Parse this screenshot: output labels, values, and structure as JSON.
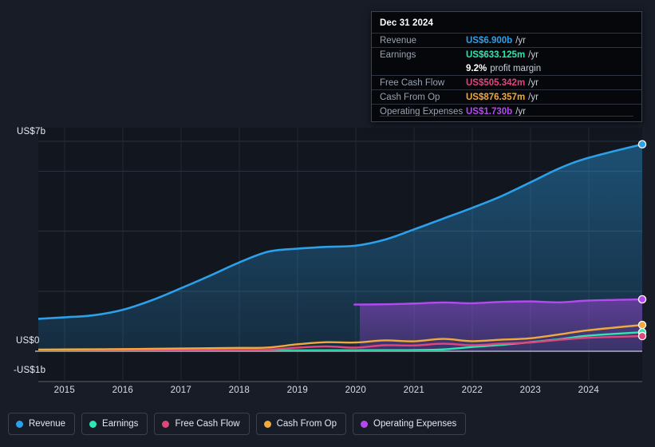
{
  "theme": {
    "background": "#171c26",
    "plot_background": "#12161f",
    "gridline": "#2b3140",
    "zero_line": "#8b8f99",
    "axis_text": "#d7dde7"
  },
  "axes": {
    "y_top_label": "US$7b",
    "y_zero_label": "US$0",
    "y_bottom_label": "-US$1b",
    "x_labels": [
      "2015",
      "2016",
      "2017",
      "2018",
      "2019",
      "2020",
      "2021",
      "2022",
      "2023",
      "2024"
    ]
  },
  "tooltip": {
    "date": "Dec 31 2024",
    "rows": [
      {
        "key": "Revenue",
        "value": "US$6.900b",
        "suffix": "/yr",
        "color": "#2ca0e8"
      },
      {
        "key": "Earnings",
        "value": "US$633.125m",
        "suffix": "/yr",
        "color": "#2ee6b0"
      },
      {
        "key": "Free Cash Flow",
        "value": "US$505.342m",
        "suffix": "/yr",
        "color": "#e0457b"
      },
      {
        "key": "Cash From Op",
        "value": "US$876.357m",
        "suffix": "/yr",
        "color": "#f0a93c"
      },
      {
        "key": "Operating Expenses",
        "value": "US$1.730b",
        "suffix": "/yr",
        "color": "#b449f0"
      }
    ],
    "profit_margin_value": "9.2%",
    "profit_margin_label": "profit margin"
  },
  "legend": [
    {
      "label": "Revenue",
      "color": "#2ca0e8"
    },
    {
      "label": "Earnings",
      "color": "#2ee6b0"
    },
    {
      "label": "Free Cash Flow",
      "color": "#e0457b"
    },
    {
      "label": "Cash From Op",
      "color": "#f0a93c"
    },
    {
      "label": "Operating Expenses",
      "color": "#b449f0"
    }
  ],
  "chart_data": {
    "type": "area",
    "title": "",
    "xlabel": "",
    "ylabel": "US$",
    "ylim": [
      -1,
      7
    ],
    "units": "US$ billions per year",
    "grid": true,
    "legend_position": "bottom",
    "x": [
      2014.55,
      2015,
      2015.5,
      2016,
      2016.5,
      2017,
      2017.5,
      2018,
      2018.5,
      2019,
      2019.5,
      2020,
      2020.5,
      2021,
      2021.5,
      2022,
      2022.5,
      2023,
      2023.5,
      2024,
      2024.92
    ],
    "series": [
      {
        "name": "Revenue",
        "color": "#2ca0e8",
        "fill": true,
        "values": [
          1.08,
          1.13,
          1.2,
          1.38,
          1.7,
          2.1,
          2.52,
          2.96,
          3.32,
          3.42,
          3.48,
          3.52,
          3.72,
          4.06,
          4.42,
          4.78,
          5.17,
          5.63,
          6.1,
          6.45,
          6.9
        ]
      },
      {
        "name": "Operating Expenses",
        "color": "#b449f0",
        "fill": true,
        "start_x": 2020.07,
        "values": [
          null,
          null,
          null,
          null,
          null,
          null,
          null,
          null,
          null,
          null,
          null,
          1.555,
          1.565,
          1.59,
          1.625,
          1.6,
          1.645,
          1.66,
          1.63,
          1.69,
          1.73
        ]
      },
      {
        "name": "Cash From Op",
        "color": "#f0a93c",
        "fill": false,
        "values": [
          0.055,
          0.06,
          0.065,
          0.07,
          0.08,
          0.09,
          0.1,
          0.11,
          0.125,
          0.23,
          0.3,
          0.29,
          0.36,
          0.33,
          0.41,
          0.335,
          0.385,
          0.43,
          0.56,
          0.7,
          0.876
        ]
      },
      {
        "name": "Earnings",
        "color": "#2ee6b0",
        "fill": false,
        "values": [
          0.01,
          0.012,
          0.014,
          0.016,
          0.018,
          0.02,
          0.022,
          0.024,
          0.026,
          0.028,
          0.03,
          0.032,
          0.034,
          0.038,
          0.06,
          0.14,
          0.21,
          0.3,
          0.4,
          0.52,
          0.633
        ]
      },
      {
        "name": "Free Cash Flow",
        "color": "#e0457b",
        "fill": false,
        "values": [
          0.02,
          0.022,
          0.025,
          0.028,
          0.032,
          0.036,
          0.04,
          0.046,
          0.055,
          0.12,
          0.16,
          0.12,
          0.2,
          0.19,
          0.25,
          0.2,
          0.25,
          0.29,
          0.38,
          0.45,
          0.505
        ]
      }
    ],
    "endpoint_markers": [
      {
        "name": "Revenue",
        "value": 6.9,
        "color": "#2ca0e8"
      },
      {
        "name": "Operating Expenses",
        "value": 1.73,
        "color": "#b449f0"
      },
      {
        "name": "Cash From Op",
        "value": 0.876,
        "color": "#f0a93c"
      },
      {
        "name": "Earnings",
        "value": 0.633,
        "color": "#2ee6b0"
      },
      {
        "name": "Free Cash Flow",
        "value": 0.505,
        "color": "#e0457b"
      }
    ]
  }
}
